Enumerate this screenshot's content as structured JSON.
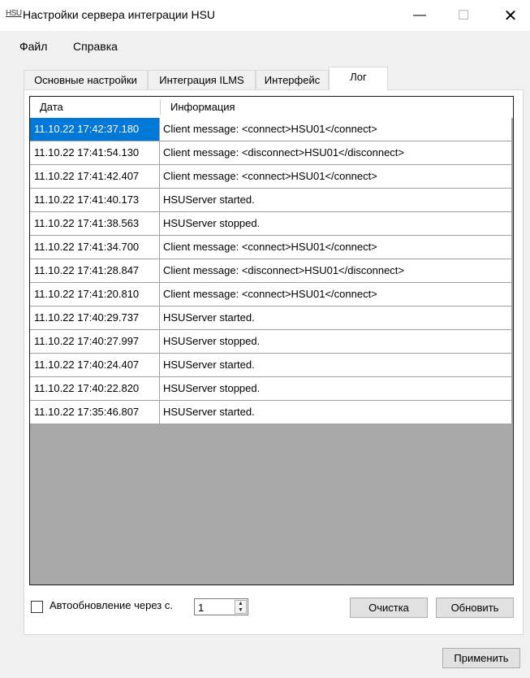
{
  "window": {
    "icon_text": "HSU",
    "title": "Настройки сервера интеграции HSU",
    "minimize": "—",
    "maximize": "☐",
    "close": "✕"
  },
  "menu": {
    "items": [
      "Файл",
      "Справка"
    ]
  },
  "tabs": [
    {
      "label": "Основные настройки",
      "active": false
    },
    {
      "label": "Интеграция ILMS",
      "active": false
    },
    {
      "label": "Интерфейс",
      "active": false
    },
    {
      "label": "Лог",
      "active": true
    }
  ],
  "log": {
    "columns": [
      "Дата",
      "Информация"
    ],
    "rows": [
      {
        "date": "11.10.22 17:42:37.180",
        "info": "Client message: <connect>HSU01</connect>",
        "selected": true
      },
      {
        "date": "11.10.22 17:41:54.130",
        "info": "Client message: <disconnect>HSU01</disconnect>"
      },
      {
        "date": "11.10.22 17:41:42.407",
        "info": "Client message: <connect>HSU01</connect>"
      },
      {
        "date": "11.10.22 17:41:40.173",
        "info": "HSUServer started."
      },
      {
        "date": "11.10.22 17:41:38.563",
        "info": "HSUServer stopped."
      },
      {
        "date": "11.10.22 17:41:34.700",
        "info": "Client message: <connect>HSU01</connect>"
      },
      {
        "date": "11.10.22 17:41:28.847",
        "info": "Client message: <disconnect>HSU01</disconnect>"
      },
      {
        "date": "11.10.22 17:41:20.810",
        "info": "Client message: <connect>HSU01</connect>"
      },
      {
        "date": "11.10.22 17:40:29.737",
        "info": "HSUServer started."
      },
      {
        "date": "11.10.22 17:40:27.997",
        "info": "HSUServer stopped."
      },
      {
        "date": "11.10.22 17:40:24.407",
        "info": "HSUServer started."
      },
      {
        "date": "11.10.22 17:40:22.820",
        "info": "HSUServer stopped."
      },
      {
        "date": "11.10.22 17:35:46.807",
        "info": "HSUServer started."
      }
    ]
  },
  "controls": {
    "autorefresh_label": "Автообновление через с.",
    "autorefresh_checked": false,
    "interval_value": "1",
    "spin_up": "▲",
    "spin_down": "▼",
    "clear_label": "Очистка",
    "refresh_label": "Обновить",
    "apply_label": "Применить"
  }
}
